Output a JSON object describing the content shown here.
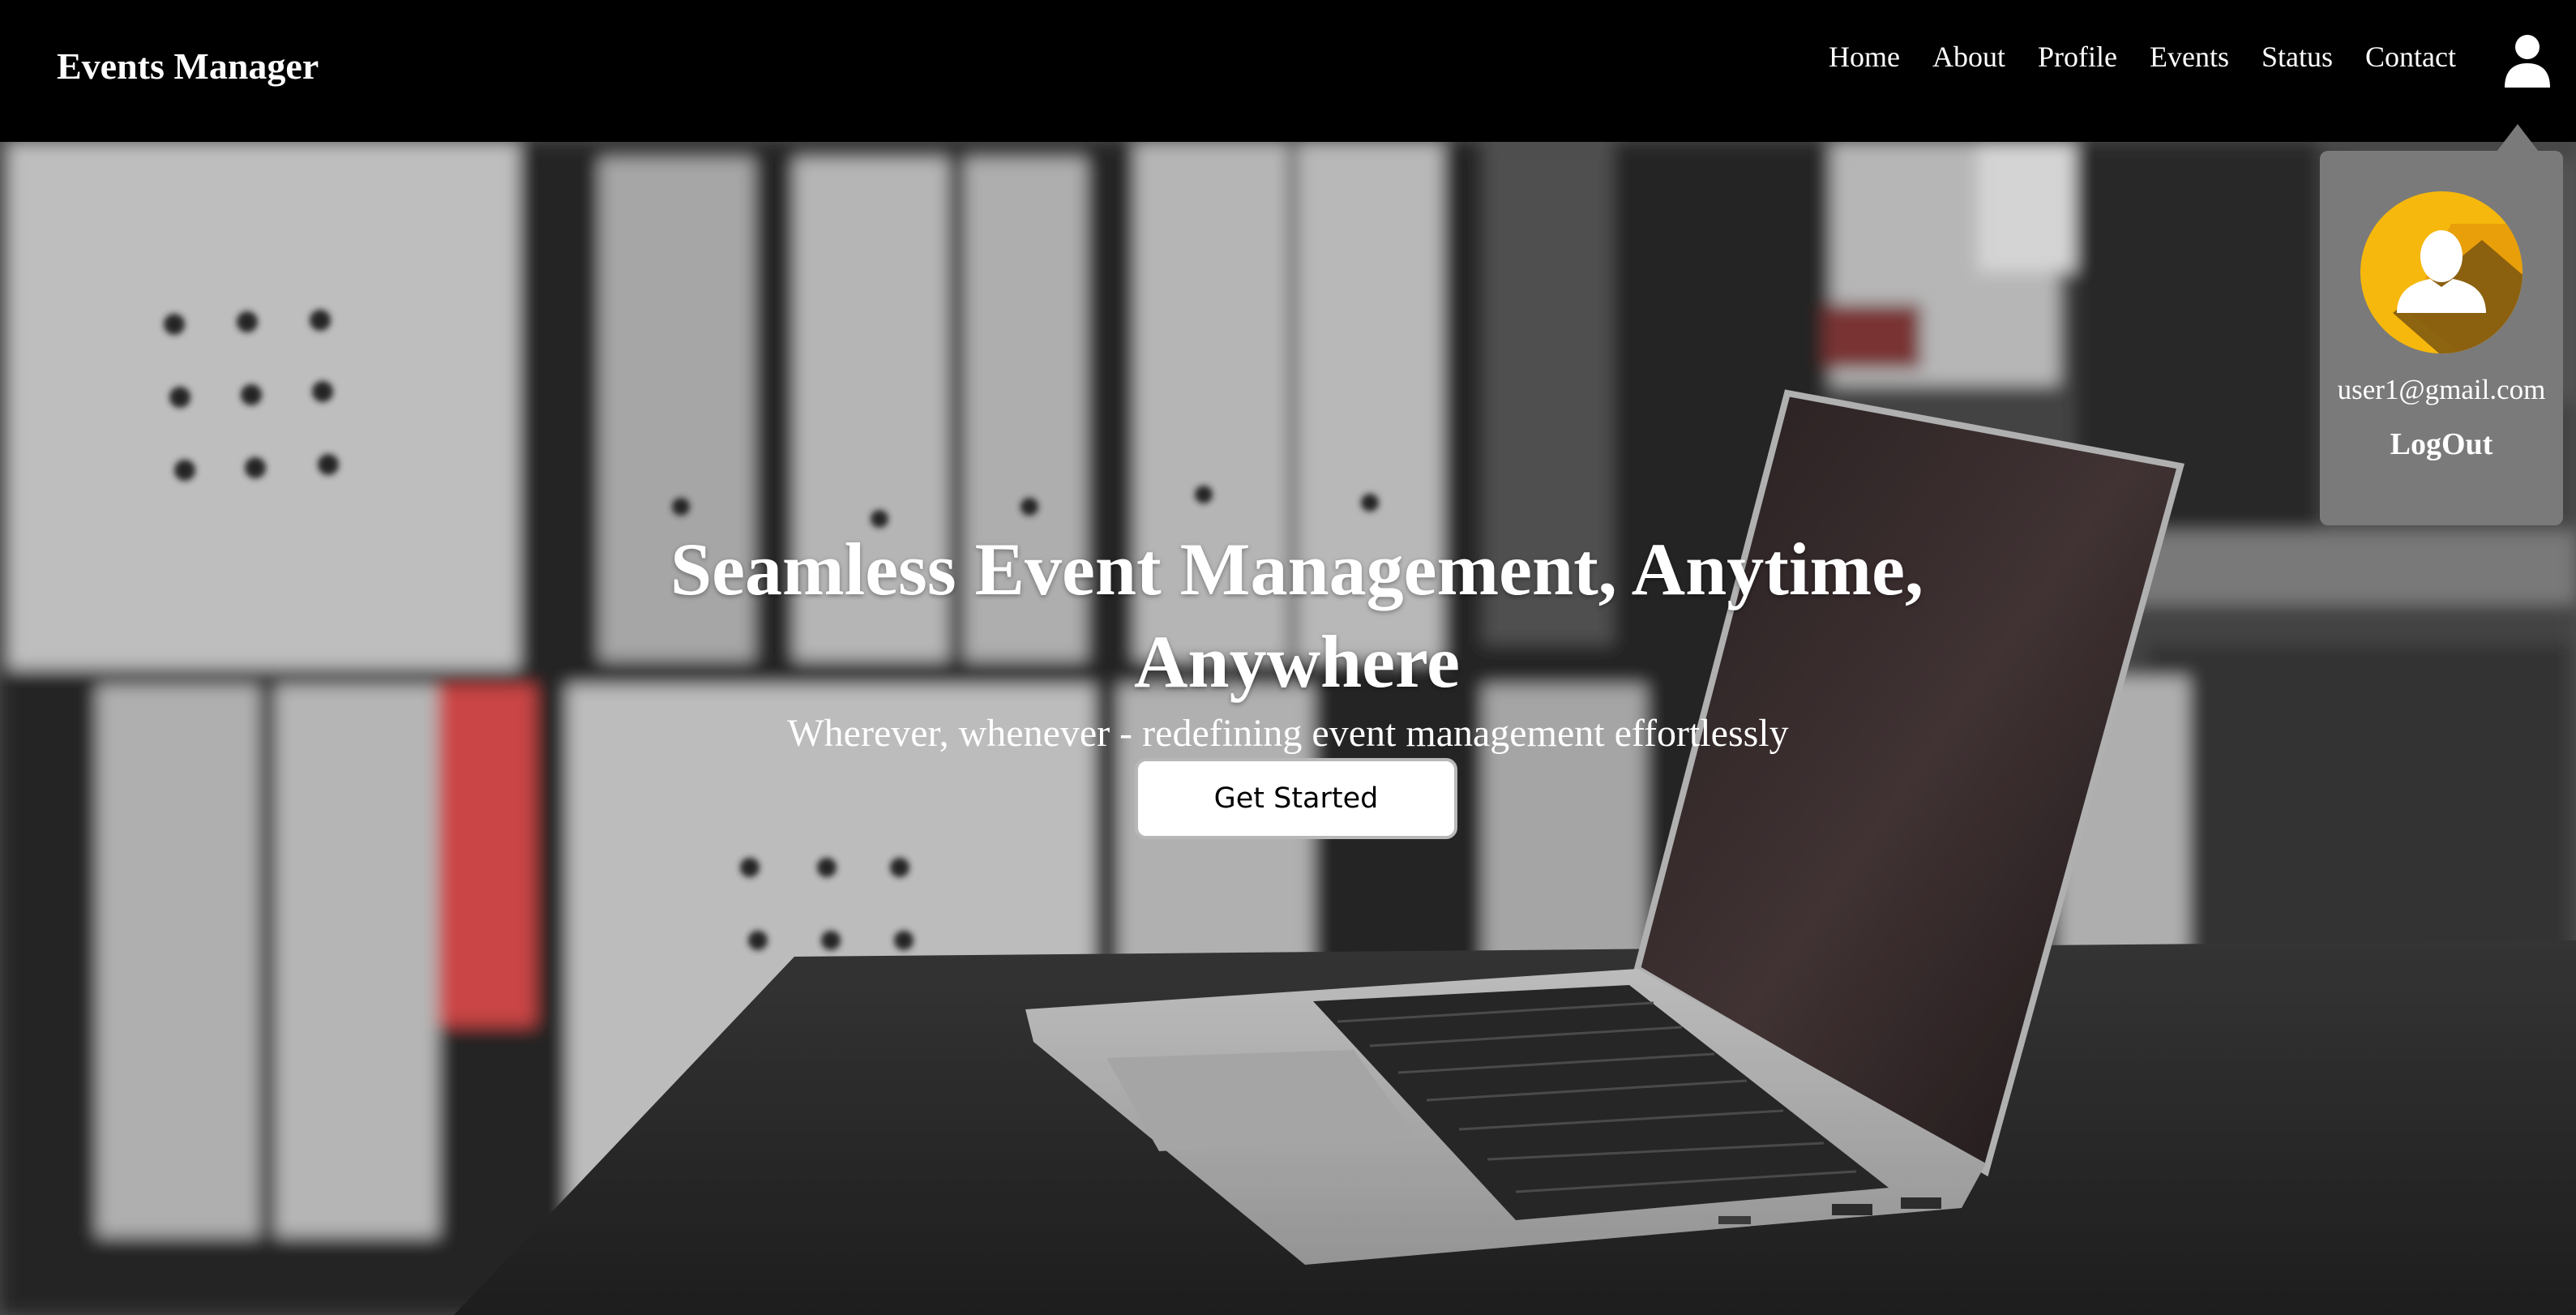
{
  "brand": {
    "title": "Events Manager"
  },
  "nav": {
    "links": [
      {
        "label": "Home"
      },
      {
        "label": "About"
      },
      {
        "label": "Profile"
      },
      {
        "label": "Events"
      },
      {
        "label": "Status"
      },
      {
        "label": "Contact"
      }
    ],
    "user_icon": "user-icon"
  },
  "hero": {
    "title": "Seamless Event Management, Anytime, Anywhere",
    "subtitle": "Wherever, whenever - redefining event management effortlessly",
    "cta_label": "Get Started"
  },
  "user_menu": {
    "avatar_icon": "avatar-icon",
    "email": "user1@gmail.com",
    "logout_label": "LogOut"
  },
  "colors": {
    "navbar_bg": "#000000",
    "dropdown_bg": "#7a7a7a",
    "avatar_yellow": "#f6b80c"
  }
}
